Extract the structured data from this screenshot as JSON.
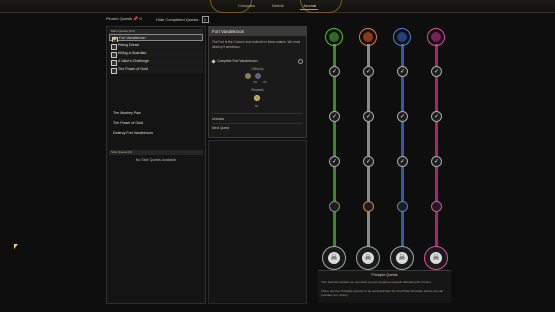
{
  "tabs": [
    {
      "label": "Compass",
      "active": false
    },
    {
      "label": "Deeds",
      "active": false
    },
    {
      "label": "Journal",
      "active": true
    }
  ],
  "top_controls": {
    "pinned_quests": "Pinned Quests",
    "pinned_count": "0",
    "hide_completed": "Hide Completed Quests",
    "hide_toggle": "X"
  },
  "main_quests": {
    "header": "Main Quests (3/4)",
    "items": [
      {
        "label": "Fort Vandekroon",
        "selected": true
      },
      {
        "label": "Rising Dread",
        "selected": false
      },
      {
        "label": "Killing a Guardian",
        "selected": false
      },
      {
        "label": "A Valor's Challenge",
        "selected": false
      },
      {
        "label": "The Power of Gold",
        "selected": false
      }
    ]
  },
  "side_list": [
    "The Monkey Paw",
    "The Power of Gold",
    "Destroy Fort Vandekroon"
  ],
  "side_quests": {
    "header": "Side Quests (0)",
    "empty": "No Side Quests Available"
  },
  "detail": {
    "title": "Fort Vandekroon",
    "description": "The Fort is the Crown's true foothold in these waters. We must destroy it somehow.",
    "objective": "Complete Fort Vandekroon",
    "difficulty_label": "Difficulty",
    "difficulty_values": [
      "7W",
      "7D"
    ],
    "rewards_label": "Rewards",
    "reward_value": "50",
    "unlocks_label": "Unlocks",
    "unlocks_value": "Next Quest"
  },
  "principle": {
    "title": "Principle Quests",
    "line1": "The Journal contains an overview of your progress towards defeating the Crown.",
    "line2": "There are five Principle Quests to be accomplished for any Pirate Principle before we can proclaim our victory.",
    "columns": [
      {
        "name": "green",
        "color": "#55c23c",
        "nodes": [
          true,
          true,
          true,
          false
        ]
      },
      {
        "name": "orange",
        "color": "#e07a3a",
        "nodes": [
          true,
          true,
          true,
          false
        ]
      },
      {
        "name": "blue",
        "color": "#4f7fe0",
        "nodes": [
          true,
          true,
          true,
          false
        ]
      },
      {
        "name": "pink",
        "color": "#e04aa0",
        "nodes": [
          true,
          true,
          true,
          false
        ]
      }
    ]
  },
  "colors": {
    "accent": "#b8964e",
    "panel": "#1a1a1a"
  }
}
